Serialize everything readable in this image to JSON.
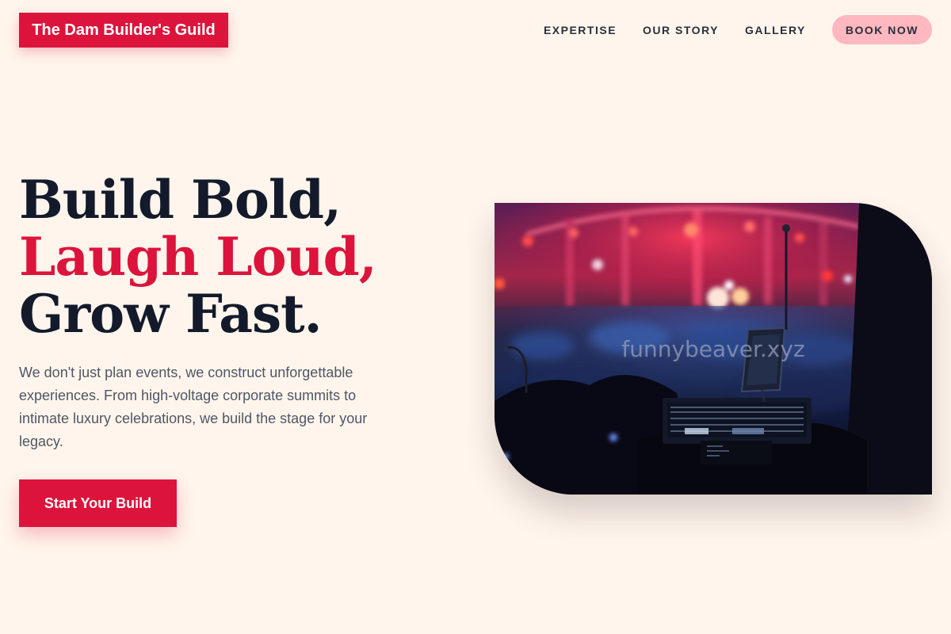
{
  "brand": {
    "name": "The Dam Builder's Guild"
  },
  "nav": {
    "items": [
      {
        "label": "EXPERTISE"
      },
      {
        "label": "OUR STORY"
      },
      {
        "label": "GALLERY"
      }
    ],
    "cta_label": "BOOK NOW"
  },
  "hero": {
    "headline_line1": "Build Bold,",
    "headline_line2": "Laugh Loud,",
    "headline_line3": "Grow Fast.",
    "description": "We don't just plan events, we construct unforgettable experiences. From high-voltage corporate summits to intimate luxury celebrations, we build the stage for your legacy.",
    "cta_label": "Start Your Build",
    "image_watermark": "funnybeaver.xyz"
  },
  "colors": {
    "background": "#fff5ec",
    "accent": "#dc143c",
    "accent_soft": "#ffb8bf",
    "ink": "#131a2b",
    "muted": "#4f5666"
  }
}
